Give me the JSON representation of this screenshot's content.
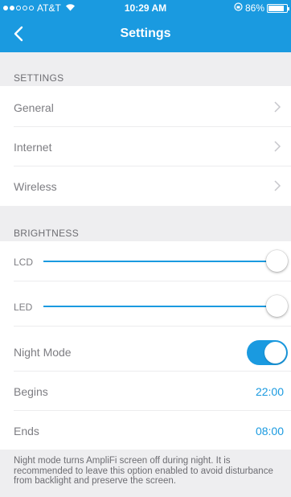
{
  "status_bar": {
    "carrier": "AT&T",
    "time": "10:29 AM",
    "battery": "86%",
    "battery_level": 0.86
  },
  "nav": {
    "title": "Settings",
    "back_icon": "chevron-left-icon"
  },
  "sections": {
    "settings": {
      "header": "SETTINGS",
      "items": [
        {
          "label": "General"
        },
        {
          "label": "Internet"
        },
        {
          "label": "Wireless"
        }
      ]
    },
    "brightness": {
      "header": "BRIGHTNESS",
      "lcd": {
        "label": "LCD",
        "level": 1.0
      },
      "led": {
        "label": "LED",
        "level": 1.0
      },
      "night_mode": {
        "label": "Night Mode",
        "enabled": true
      },
      "begins": {
        "label": "Begins",
        "value": "22:00"
      },
      "ends": {
        "label": "Ends",
        "value": "08:00"
      }
    }
  },
  "footer_note": "Night mode turns AmpliFi screen off during night. It is recommended to leave this option enabled to avoid disturbance from backlight and preserve the screen.",
  "colors": {
    "accent": "#1a9ae0",
    "group_background": "#eeeef0",
    "label_text": "#7d7d82"
  }
}
